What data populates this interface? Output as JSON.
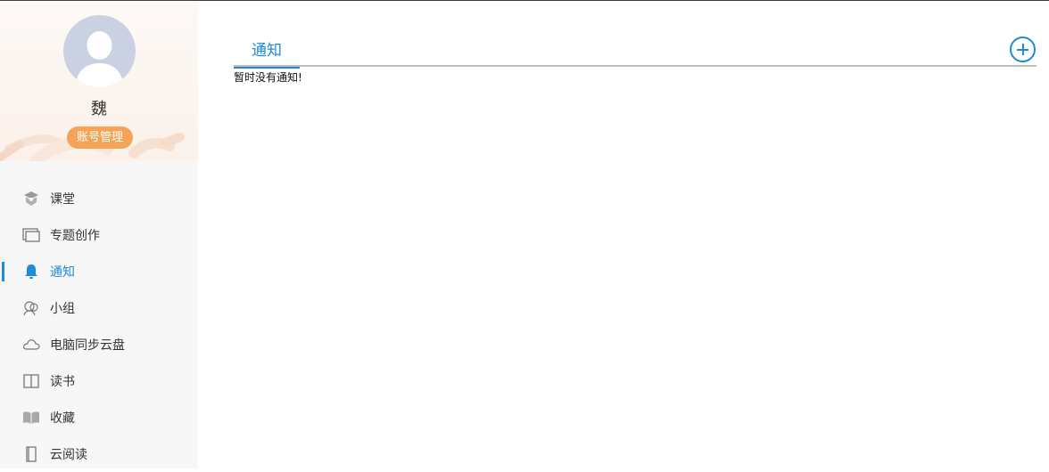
{
  "profile": {
    "username": "魏",
    "account_button": "账号管理"
  },
  "menu": {
    "items": [
      {
        "label": "课堂",
        "icon": "classroom-icon"
      },
      {
        "label": "专题创作",
        "icon": "topic-create-icon"
      },
      {
        "label": "通知",
        "icon": "bell-icon",
        "active": true
      },
      {
        "label": "小组",
        "icon": "group-icon"
      },
      {
        "label": "电脑同步云盘",
        "icon": "cloud-icon"
      },
      {
        "label": "读书",
        "icon": "book-icon"
      },
      {
        "label": "收藏",
        "icon": "favorites-book-icon"
      },
      {
        "label": "云阅读",
        "icon": "cloud-reading-icon"
      }
    ]
  },
  "main": {
    "tab_label": "通知",
    "add_icon": "plus-circle-icon",
    "empty_message": "暂时没有通知!"
  },
  "colors": {
    "accent": "#1e8ad8",
    "account_button": "#f5a356",
    "sidebar_bg": "#f7f7f7"
  }
}
